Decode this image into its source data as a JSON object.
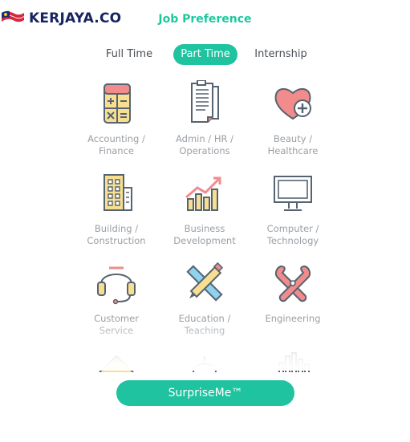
{
  "brand": {
    "name": "KERJAYA.CO"
  },
  "header": {
    "title": "Job Preference"
  },
  "tabs": [
    {
      "label": "Full Time",
      "active": false
    },
    {
      "label": "Part Time",
      "active": true
    },
    {
      "label": "Internship",
      "active": false
    }
  ],
  "categories": [
    {
      "label": "Accounting /\nFinance",
      "icon": "calculator-icon"
    },
    {
      "label": "Admin / HR /\nOperations",
      "icon": "documents-icon"
    },
    {
      "label": "Beauty /\nHealthcare",
      "icon": "heart-plus-icon"
    },
    {
      "label": "Building /\nConstruction",
      "icon": "building-icon"
    },
    {
      "label": "Business\nDevelopment",
      "icon": "growth-chart-icon"
    },
    {
      "label": "Computer /\nTechnology",
      "icon": "monitor-icon"
    },
    {
      "label": "Customer\nService",
      "icon": "headset-icon"
    },
    {
      "label": "Education /\nTeaching",
      "icon": "pencil-ruler-icon"
    },
    {
      "label": "Engineering",
      "icon": "tools-icon"
    }
  ],
  "cta": {
    "label": "SurpriseMe™"
  },
  "colors": {
    "accent": "#1fc3a0",
    "brand": "#17245e",
    "icon_stroke": "#566370",
    "icon_pink": "#f28b8b",
    "icon_yellow": "#f7df8f"
  }
}
